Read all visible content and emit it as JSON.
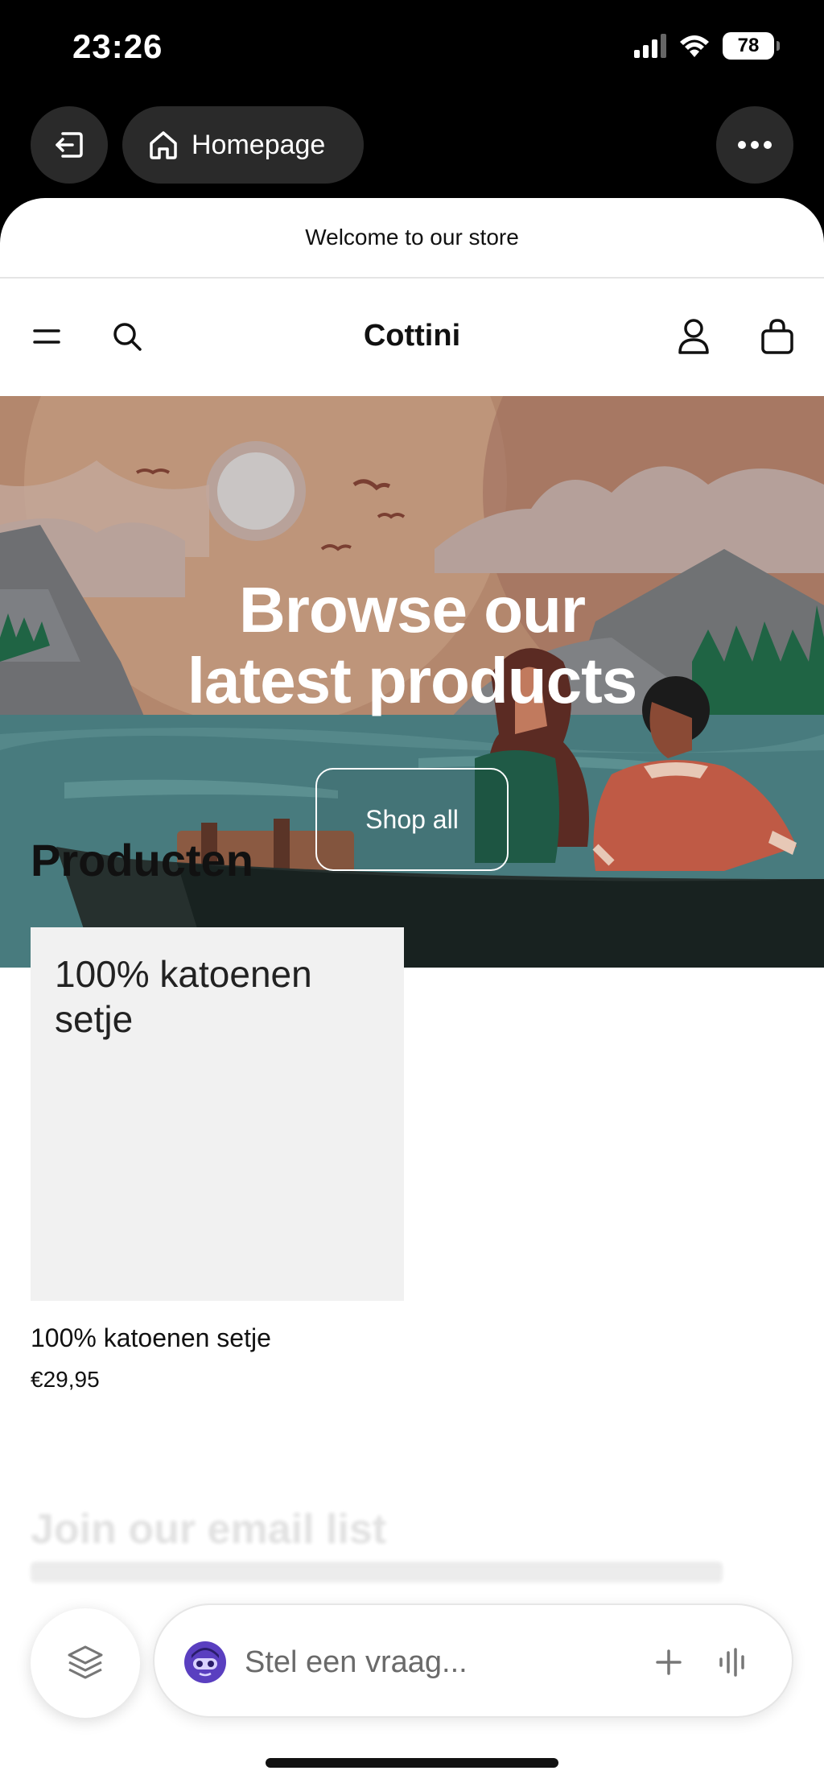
{
  "status_bar": {
    "time": "23:26",
    "battery": "78"
  },
  "browser_nav": {
    "home_label": "Homepage"
  },
  "announcement": "Welcome to our store",
  "header": {
    "brand": "Cottini"
  },
  "hero": {
    "title_line1": "Browse our",
    "title_line2": "latest products",
    "button": "Shop all"
  },
  "products": {
    "title": "Producten",
    "items": [
      {
        "placeholder": "100% katoenen setje",
        "name": "100% katoenen setje",
        "price": "€29,95"
      }
    ]
  },
  "footer_teaser": {
    "heading": "Join our email list"
  },
  "chat": {
    "placeholder": "Stel een vraag..."
  },
  "icons": [
    "exit-icon",
    "home-icon",
    "more-icon",
    "menu-icon",
    "search-icon",
    "account-icon",
    "cart-icon",
    "layers-icon",
    "assistant-avatar",
    "plus-icon",
    "voice-icon"
  ]
}
